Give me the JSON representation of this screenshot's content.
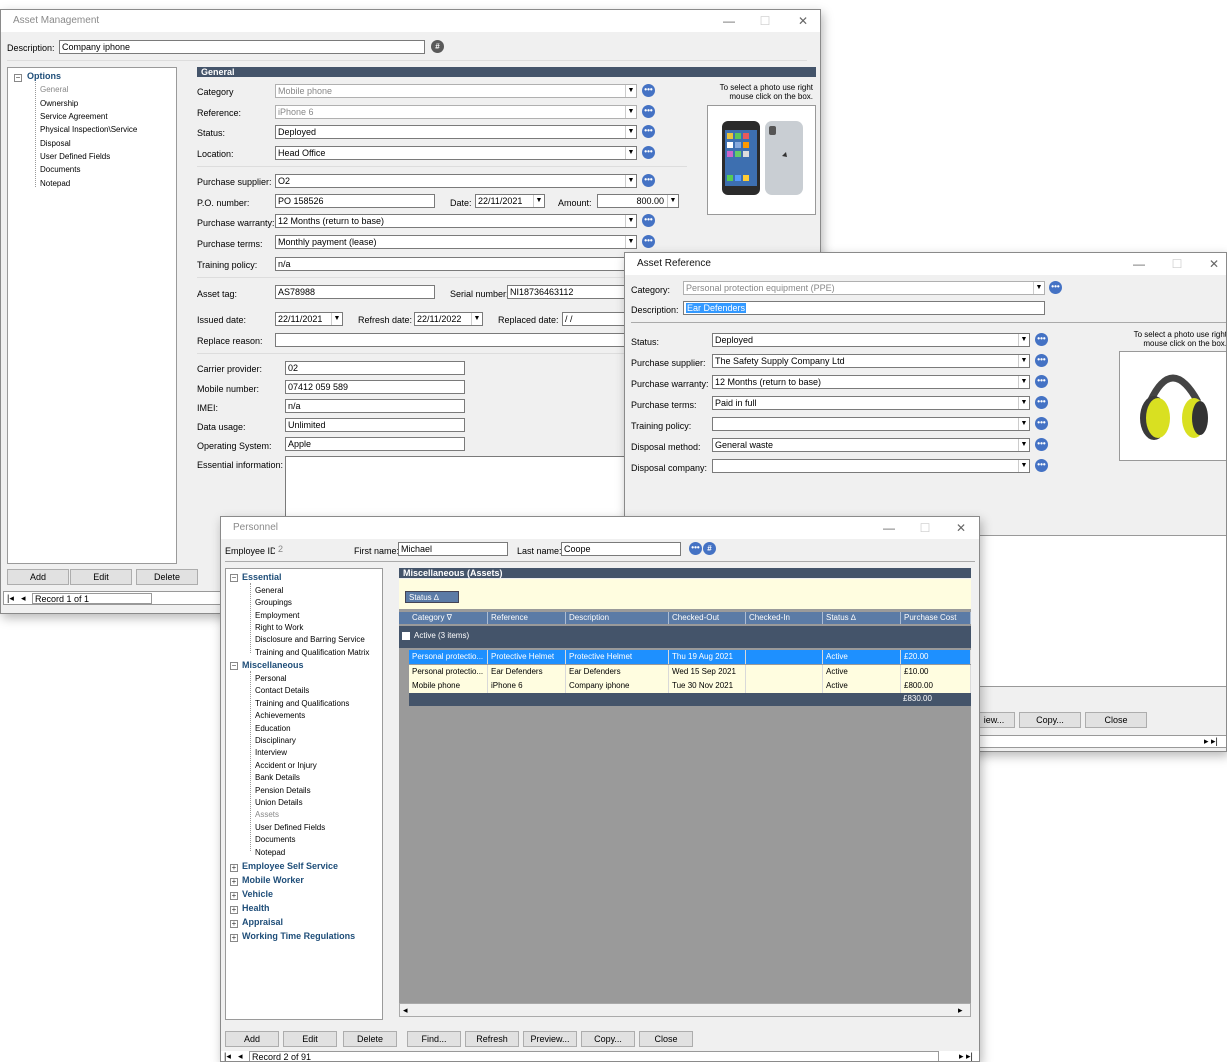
{
  "asset_window": {
    "title": "Asset Management",
    "description_label": "Description:",
    "description_value": "Company iphone",
    "tree_header": "Options",
    "tree_items": [
      "General",
      "Ownership",
      "Service Agreement",
      "Physical Inspection\\Service",
      "Disposal",
      "User Defined Fields",
      "Documents",
      "Notepad"
    ],
    "section_title": "General",
    "photo_hint": "To select a photo use right mouse click on the box.",
    "fields": {
      "category_label": "Category",
      "category_value": "Mobile phone",
      "reference_label": "Reference:",
      "reference_value": "iPhone 6",
      "status_label": "Status:",
      "status_value": "Deployed",
      "location_label": "Location:",
      "location_value": "Head Office",
      "supplier_label": "Purchase supplier:",
      "supplier_value": "O2",
      "po_label": "P.O. number:",
      "po_value": "PO 158526",
      "date_label": "Date:",
      "date_value": "22/11/2021",
      "amount_label": "Amount:",
      "amount_value": "800.00",
      "warranty_label": "Purchase warranty:",
      "warranty_value": "12 Months (return to base)",
      "terms_label": "Purchase terms:",
      "terms_value": "Monthly payment  (lease)",
      "training_label": "Training policy:",
      "training_value": "n/a",
      "tag_label": "Asset tag:",
      "tag_value": "AS78988",
      "serial_label": "Serial number:",
      "serial_value": "NI18736463112",
      "issued_label": "Issued date:",
      "issued_value": "22/11/2021",
      "refresh_label": "Refresh date:",
      "refresh_value": "22/11/2022",
      "replaced_label": "Replaced date:",
      "replaced_value": " / /",
      "replace_reason_label": "Replace reason:",
      "carrier_label": "Carrier provider:",
      "carrier_value": "02",
      "mobile_label": "Mobile number:",
      "mobile_value": "07412 059 589",
      "imei_label": "IMEI:",
      "imei_value": "n/a",
      "data_label": "Data usage:",
      "data_value": "Unlimited",
      "os_label": "Operating System:",
      "os_value": "Apple",
      "essential_label": "Essential information:"
    },
    "buttons": {
      "add": "Add",
      "edit": "Edit",
      "delete": "Delete"
    },
    "record_nav": "Record 1 of 1"
  },
  "ref_window": {
    "title": "Asset Reference",
    "category_label": "Category:",
    "category_value": "Personal protection equipment (PPE)",
    "description_label": "Description:",
    "description_value": "Ear Defenders",
    "photo_hint": "To select a photo use right mouse click on the box.",
    "status_label": "Status:",
    "status_value": "Deployed",
    "supplier_label": "Purchase supplier:",
    "supplier_value": "The Safety Supply Company Ltd",
    "warranty_label": "Purchase warranty:",
    "warranty_value": "12 Months (return to base)",
    "terms_label": "Purchase terms:",
    "terms_value": "Paid in full",
    "training_label": "Training policy:",
    "training_value": "",
    "disposal_method_label": "Disposal method:",
    "disposal_method_value": "General waste",
    "disposal_company_label": "Disposal company:",
    "disposal_company_value": "",
    "buttons": {
      "preview": "iew...",
      "copy": "Copy...",
      "close": "Close"
    }
  },
  "personnel_window": {
    "title": "Personnel",
    "employee_id_label": "Employee ID:",
    "employee_id_value": "2",
    "first_name_label": "First name:",
    "first_name_value": "Michael",
    "last_name_label": "Last name:",
    "last_name_value": "Coope",
    "tree": {
      "essential": "Essential",
      "essential_items": [
        "General",
        "Groupings",
        "Employment",
        "Right to Work",
        "Disclosure and Barring Service",
        "Training and Qualification Matrix"
      ],
      "misc": "Miscellaneous",
      "misc_items": [
        "Personal",
        "Contact Details",
        "Training and Qualifications",
        "Achievements",
        "Education",
        "Disciplinary",
        "Interview",
        "Accident or Injury",
        "Bank Details",
        "Pension Details",
        "Union Details",
        "Assets",
        "User Defined Fields",
        "Documents",
        "Notepad"
      ],
      "collapsed": [
        "Employee Self Service",
        "Mobile Worker",
        "Vehicle",
        "Health",
        "Appraisal",
        "Working Time Regulations"
      ]
    },
    "section_title": "Miscellaneous (Assets)",
    "group_chip": "Status ∆",
    "columns": [
      "Category ∇",
      "Reference",
      "Description",
      "Checked-Out",
      "Checked-In",
      "Status ∆",
      "Purchase Cost"
    ],
    "group_row": "Active (3 items)",
    "rows": [
      [
        "Personal protectio...",
        "Protective Helmet",
        "Protective Helmet",
        "Thu 19 Aug 2021",
        "",
        "Active",
        "£20.00"
      ],
      [
        "Personal protectio...",
        "Ear Defenders",
        "Ear Defenders",
        "Wed 15 Sep 2021",
        "",
        "Active",
        "£10.00"
      ],
      [
        "Mobile phone",
        "iPhone 6",
        "Company iphone",
        "Tue 30 Nov 2021",
        "",
        "Active",
        "£800.00"
      ]
    ],
    "total": "£830.00",
    "buttons": {
      "add": "Add",
      "edit": "Edit",
      "delete": "Delete",
      "find": "Find...",
      "refresh": "Refresh",
      "preview": "Preview...",
      "copy": "Copy...",
      "close": "Close"
    },
    "record_nav": "Record 2 of 91"
  }
}
